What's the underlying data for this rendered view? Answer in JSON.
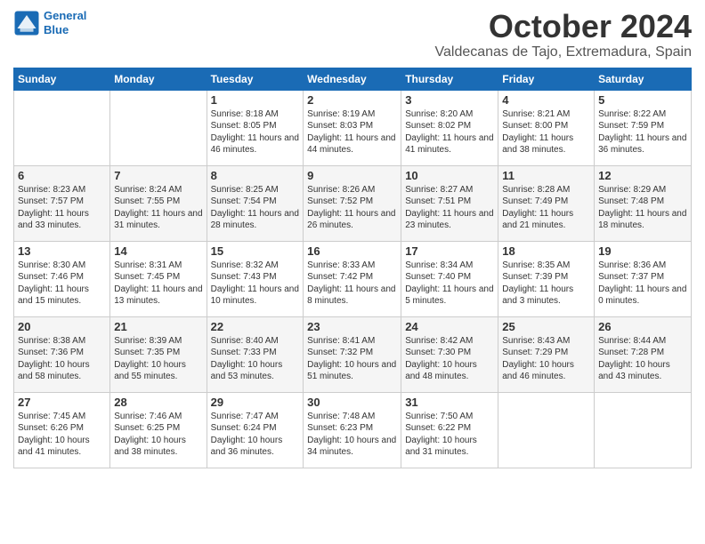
{
  "header": {
    "logo_line1": "General",
    "logo_line2": "Blue",
    "month": "October 2024",
    "location": "Valdecanas de Tajo, Extremadura, Spain"
  },
  "columns": [
    "Sunday",
    "Monday",
    "Tuesday",
    "Wednesday",
    "Thursday",
    "Friday",
    "Saturday"
  ],
  "weeks": [
    [
      {
        "day": "",
        "info": ""
      },
      {
        "day": "",
        "info": ""
      },
      {
        "day": "1",
        "info": "Sunrise: 8:18 AM\nSunset: 8:05 PM\nDaylight: 11 hours and 46 minutes."
      },
      {
        "day": "2",
        "info": "Sunrise: 8:19 AM\nSunset: 8:03 PM\nDaylight: 11 hours and 44 minutes."
      },
      {
        "day": "3",
        "info": "Sunrise: 8:20 AM\nSunset: 8:02 PM\nDaylight: 11 hours and 41 minutes."
      },
      {
        "day": "4",
        "info": "Sunrise: 8:21 AM\nSunset: 8:00 PM\nDaylight: 11 hours and 38 minutes."
      },
      {
        "day": "5",
        "info": "Sunrise: 8:22 AM\nSunset: 7:59 PM\nDaylight: 11 hours and 36 minutes."
      }
    ],
    [
      {
        "day": "6",
        "info": "Sunrise: 8:23 AM\nSunset: 7:57 PM\nDaylight: 11 hours and 33 minutes."
      },
      {
        "day": "7",
        "info": "Sunrise: 8:24 AM\nSunset: 7:55 PM\nDaylight: 11 hours and 31 minutes."
      },
      {
        "day": "8",
        "info": "Sunrise: 8:25 AM\nSunset: 7:54 PM\nDaylight: 11 hours and 28 minutes."
      },
      {
        "day": "9",
        "info": "Sunrise: 8:26 AM\nSunset: 7:52 PM\nDaylight: 11 hours and 26 minutes."
      },
      {
        "day": "10",
        "info": "Sunrise: 8:27 AM\nSunset: 7:51 PM\nDaylight: 11 hours and 23 minutes."
      },
      {
        "day": "11",
        "info": "Sunrise: 8:28 AM\nSunset: 7:49 PM\nDaylight: 11 hours and 21 minutes."
      },
      {
        "day": "12",
        "info": "Sunrise: 8:29 AM\nSunset: 7:48 PM\nDaylight: 11 hours and 18 minutes."
      }
    ],
    [
      {
        "day": "13",
        "info": "Sunrise: 8:30 AM\nSunset: 7:46 PM\nDaylight: 11 hours and 15 minutes."
      },
      {
        "day": "14",
        "info": "Sunrise: 8:31 AM\nSunset: 7:45 PM\nDaylight: 11 hours and 13 minutes."
      },
      {
        "day": "15",
        "info": "Sunrise: 8:32 AM\nSunset: 7:43 PM\nDaylight: 11 hours and 10 minutes."
      },
      {
        "day": "16",
        "info": "Sunrise: 8:33 AM\nSunset: 7:42 PM\nDaylight: 11 hours and 8 minutes."
      },
      {
        "day": "17",
        "info": "Sunrise: 8:34 AM\nSunset: 7:40 PM\nDaylight: 11 hours and 5 minutes."
      },
      {
        "day": "18",
        "info": "Sunrise: 8:35 AM\nSunset: 7:39 PM\nDaylight: 11 hours and 3 minutes."
      },
      {
        "day": "19",
        "info": "Sunrise: 8:36 AM\nSunset: 7:37 PM\nDaylight: 11 hours and 0 minutes."
      }
    ],
    [
      {
        "day": "20",
        "info": "Sunrise: 8:38 AM\nSunset: 7:36 PM\nDaylight: 10 hours and 58 minutes."
      },
      {
        "day": "21",
        "info": "Sunrise: 8:39 AM\nSunset: 7:35 PM\nDaylight: 10 hours and 55 minutes."
      },
      {
        "day": "22",
        "info": "Sunrise: 8:40 AM\nSunset: 7:33 PM\nDaylight: 10 hours and 53 minutes."
      },
      {
        "day": "23",
        "info": "Sunrise: 8:41 AM\nSunset: 7:32 PM\nDaylight: 10 hours and 51 minutes."
      },
      {
        "day": "24",
        "info": "Sunrise: 8:42 AM\nSunset: 7:30 PM\nDaylight: 10 hours and 48 minutes."
      },
      {
        "day": "25",
        "info": "Sunrise: 8:43 AM\nSunset: 7:29 PM\nDaylight: 10 hours and 46 minutes."
      },
      {
        "day": "26",
        "info": "Sunrise: 8:44 AM\nSunset: 7:28 PM\nDaylight: 10 hours and 43 minutes."
      }
    ],
    [
      {
        "day": "27",
        "info": "Sunrise: 7:45 AM\nSunset: 6:26 PM\nDaylight: 10 hours and 41 minutes."
      },
      {
        "day": "28",
        "info": "Sunrise: 7:46 AM\nSunset: 6:25 PM\nDaylight: 10 hours and 38 minutes."
      },
      {
        "day": "29",
        "info": "Sunrise: 7:47 AM\nSunset: 6:24 PM\nDaylight: 10 hours and 36 minutes."
      },
      {
        "day": "30",
        "info": "Sunrise: 7:48 AM\nSunset: 6:23 PM\nDaylight: 10 hours and 34 minutes."
      },
      {
        "day": "31",
        "info": "Sunrise: 7:50 AM\nSunset: 6:22 PM\nDaylight: 10 hours and 31 minutes."
      },
      {
        "day": "",
        "info": ""
      },
      {
        "day": "",
        "info": ""
      }
    ]
  ]
}
